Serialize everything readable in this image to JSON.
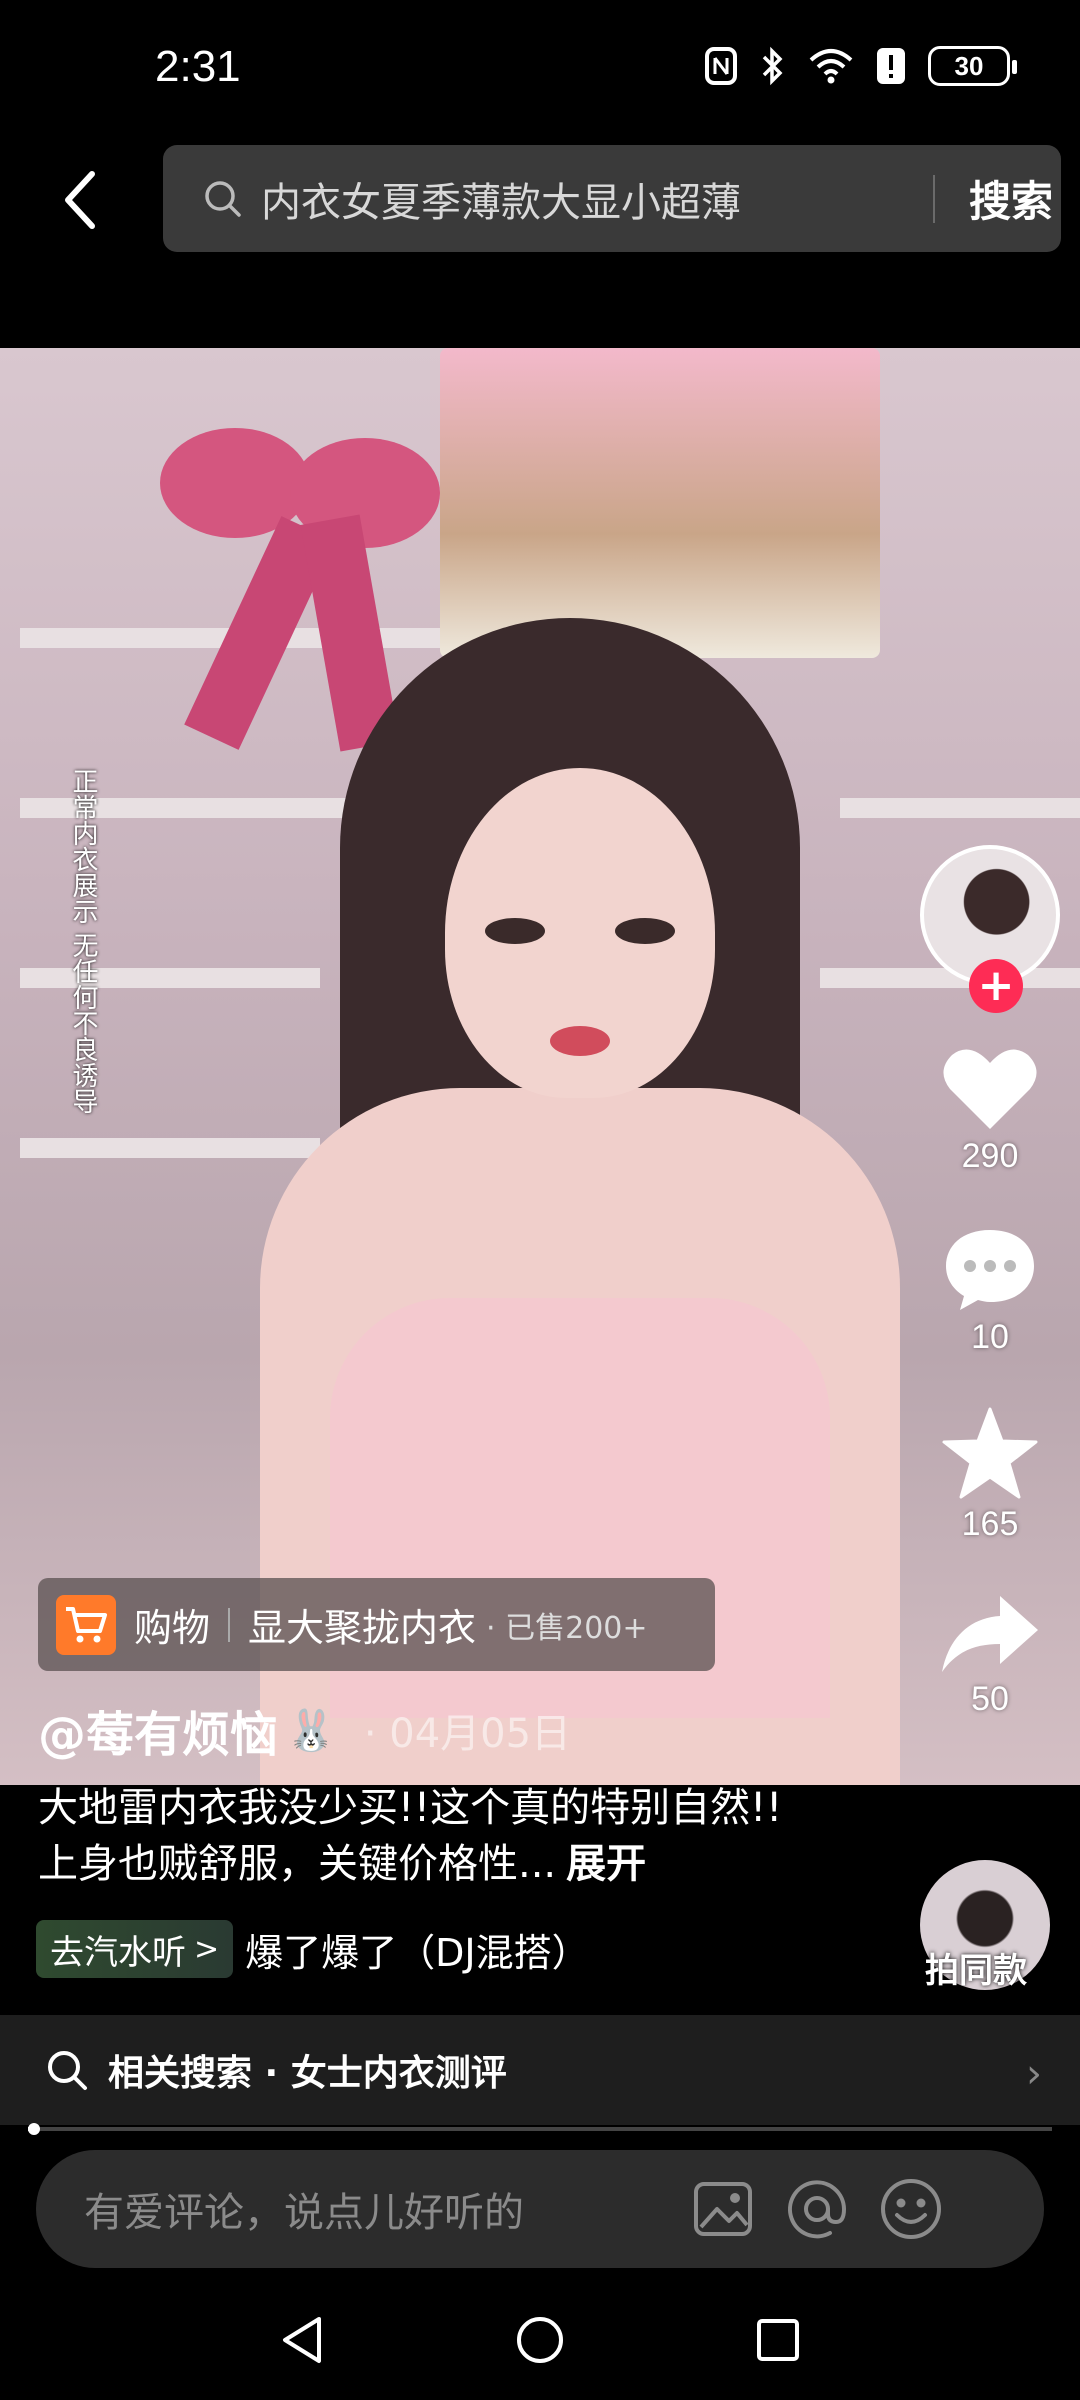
{
  "status_bar": {
    "time": "2:31",
    "battery": "30",
    "icons": [
      "nfc-icon",
      "bluetooth-icon",
      "wifi-icon",
      "alert-icon",
      "battery-icon"
    ]
  },
  "search": {
    "query": "内衣女夏季薄款大显小超薄",
    "submit_label": "搜索"
  },
  "video": {
    "side_caption": "正常内衣展示 无任何不良诱导"
  },
  "actions": {
    "likes": "290",
    "comments": "10",
    "favorites": "165",
    "shares": "50",
    "follow_symbol": "+"
  },
  "shop": {
    "label": "购物",
    "product": "显大聚拢内衣",
    "sold": "· 已售200+"
  },
  "post": {
    "author": "@莓有烦恼",
    "date": "· 04月05日",
    "caption": "大地雷内衣我没少买!!这个真的特别自然!!上身也贼舒服，关键价格性...",
    "expand_label": "展开"
  },
  "music": {
    "chip_label": "去汽水听",
    "chevron": ">",
    "title": "爆了爆了（DJ混搭）"
  },
  "same_style": {
    "label": "拍同款"
  },
  "related_search": {
    "text": "相关搜索 · 女士内衣测评",
    "chevron": "›"
  },
  "progress": {
    "fraction": 0.005
  },
  "comment": {
    "placeholder": "有爱评论，说点儿好听的"
  },
  "colors": {
    "accent": "#fe2c55",
    "cart": "#ff7a2a",
    "background": "#000000"
  }
}
